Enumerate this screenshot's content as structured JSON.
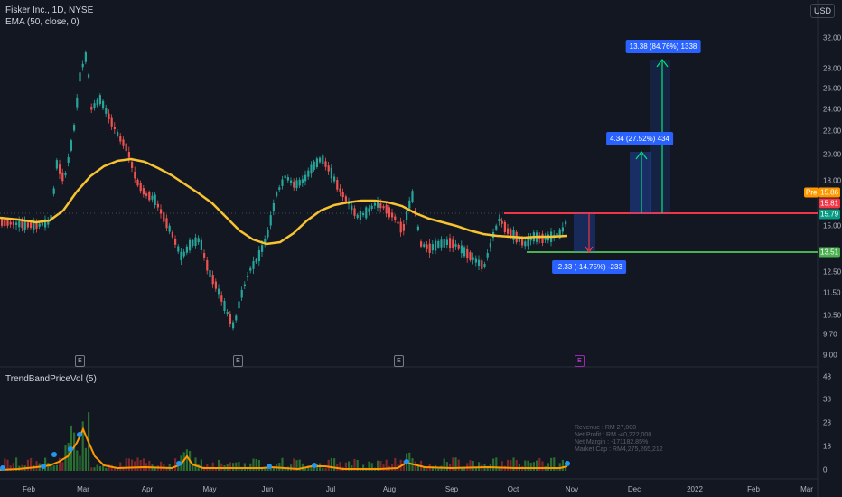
{
  "header": {
    "line1": "Fisker Inc., 1D, NYSE",
    "line2": "EMA (50, close, 0)",
    "currency_badge": "USD"
  },
  "price_axis": {
    "labels": [
      "32.00",
      "28.00",
      "26.00",
      "24.00",
      "22.00",
      "20.00",
      "18.00",
      "15.00",
      "12.50",
      "11.50",
      "10.50",
      "9.70",
      "9.00"
    ]
  },
  "price_tags": [
    {
      "label": "Pre",
      "value": "15.86",
      "color": "#ff9800"
    },
    {
      "value": "15.81",
      "color": "#f23645"
    },
    {
      "value": "15.79",
      "color": "#089981"
    },
    {
      "value": "13.51",
      "color": "#4caf50"
    }
  ],
  "annotations": {
    "upper_target": "13.38 (84.76%) 1338",
    "mid_target": "4.34 (27.52%) 434",
    "stop": "-2.33 (-14.75%) -233"
  },
  "events": [
    "E",
    "E",
    "E",
    "E"
  ],
  "volume_panel": {
    "title": "TrendBandPriceVol (5)",
    "axis_labels": [
      "48",
      "38",
      "28",
      "18",
      "0"
    ],
    "info_lines": [
      "Revenue : RM 27,000",
      "Net Profit : RM -40,222,000",
      "Net Margin : -171182.85%",
      "Market Cap : RM4,275,265,212"
    ]
  },
  "time_axis": [
    "Feb",
    "Mar",
    "Apr",
    "May",
    "Jun",
    "Jul",
    "Aug",
    "Sep",
    "Oct",
    "Nov",
    "Dec",
    "2022",
    "Feb",
    "Mar"
  ],
  "colors": {
    "up": "#26a69a",
    "down": "#ef5350",
    "ema": "#f7c331",
    "resistance": "#f23645",
    "support": "#4caf50",
    "target": "#00e676"
  }
}
